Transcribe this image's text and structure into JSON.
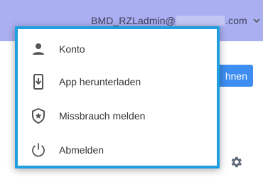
{
  "header": {
    "account_name": "BMD_RZLadmin@",
    "email_domain": ".com",
    "background_color": "#a9aff0"
  },
  "background": {
    "partial_button_label": "hnen",
    "button_color": "#3d8ef0"
  },
  "menu": {
    "border_color": "#1ea0e0",
    "items": [
      {
        "label": "Konto",
        "icon": "person-icon"
      },
      {
        "label": "App herunterladen",
        "icon": "phone-download-icon"
      },
      {
        "label": "Missbrauch melden",
        "icon": "shield-star-icon"
      },
      {
        "label": "Abmelden",
        "icon": "power-icon"
      }
    ]
  }
}
